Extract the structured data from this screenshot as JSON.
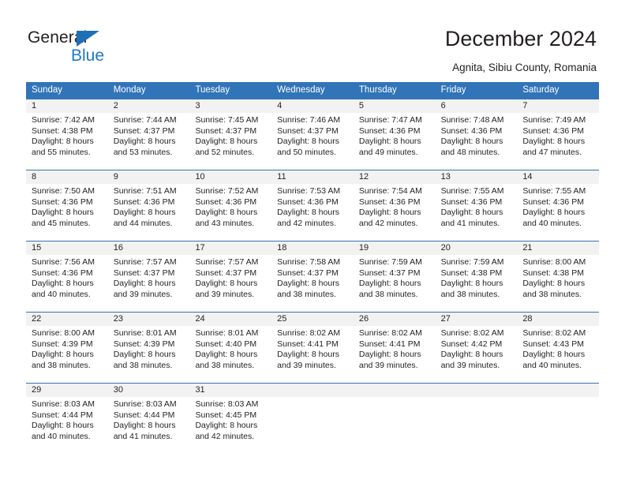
{
  "brand": {
    "name_part1": "General",
    "name_part2": "Blue",
    "triangle_color": "#1f6fb5",
    "blue_color": "#1f7ac4"
  },
  "header": {
    "title": "December 2024",
    "subtitle": "Agnita, Sibiu County, Romania"
  },
  "theme": {
    "header_blue": "#3174b8",
    "daynum_band": "#f2f2f2",
    "text": "#231f20"
  },
  "calendar": {
    "weekday_headers": [
      "Sunday",
      "Monday",
      "Tuesday",
      "Wednesday",
      "Thursday",
      "Friday",
      "Saturday"
    ],
    "weeks": [
      {
        "days": [
          {
            "num": "1",
            "sunrise": "Sunrise: 7:42 AM",
            "sunset": "Sunset: 4:38 PM",
            "daylight1": "Daylight: 8 hours",
            "daylight2": "and 55 minutes."
          },
          {
            "num": "2",
            "sunrise": "Sunrise: 7:44 AM",
            "sunset": "Sunset: 4:37 PM",
            "daylight1": "Daylight: 8 hours",
            "daylight2": "and 53 minutes."
          },
          {
            "num": "3",
            "sunrise": "Sunrise: 7:45 AM",
            "sunset": "Sunset: 4:37 PM",
            "daylight1": "Daylight: 8 hours",
            "daylight2": "and 52 minutes."
          },
          {
            "num": "4",
            "sunrise": "Sunrise: 7:46 AM",
            "sunset": "Sunset: 4:37 PM",
            "daylight1": "Daylight: 8 hours",
            "daylight2": "and 50 minutes."
          },
          {
            "num": "5",
            "sunrise": "Sunrise: 7:47 AM",
            "sunset": "Sunset: 4:36 PM",
            "daylight1": "Daylight: 8 hours",
            "daylight2": "and 49 minutes."
          },
          {
            "num": "6",
            "sunrise": "Sunrise: 7:48 AM",
            "sunset": "Sunset: 4:36 PM",
            "daylight1": "Daylight: 8 hours",
            "daylight2": "and 48 minutes."
          },
          {
            "num": "7",
            "sunrise": "Sunrise: 7:49 AM",
            "sunset": "Sunset: 4:36 PM",
            "daylight1": "Daylight: 8 hours",
            "daylight2": "and 47 minutes."
          }
        ]
      },
      {
        "days": [
          {
            "num": "8",
            "sunrise": "Sunrise: 7:50 AM",
            "sunset": "Sunset: 4:36 PM",
            "daylight1": "Daylight: 8 hours",
            "daylight2": "and 45 minutes."
          },
          {
            "num": "9",
            "sunrise": "Sunrise: 7:51 AM",
            "sunset": "Sunset: 4:36 PM",
            "daylight1": "Daylight: 8 hours",
            "daylight2": "and 44 minutes."
          },
          {
            "num": "10",
            "sunrise": "Sunrise: 7:52 AM",
            "sunset": "Sunset: 4:36 PM",
            "daylight1": "Daylight: 8 hours",
            "daylight2": "and 43 minutes."
          },
          {
            "num": "11",
            "sunrise": "Sunrise: 7:53 AM",
            "sunset": "Sunset: 4:36 PM",
            "daylight1": "Daylight: 8 hours",
            "daylight2": "and 42 minutes."
          },
          {
            "num": "12",
            "sunrise": "Sunrise: 7:54 AM",
            "sunset": "Sunset: 4:36 PM",
            "daylight1": "Daylight: 8 hours",
            "daylight2": "and 42 minutes."
          },
          {
            "num": "13",
            "sunrise": "Sunrise: 7:55 AM",
            "sunset": "Sunset: 4:36 PM",
            "daylight1": "Daylight: 8 hours",
            "daylight2": "and 41 minutes."
          },
          {
            "num": "14",
            "sunrise": "Sunrise: 7:55 AM",
            "sunset": "Sunset: 4:36 PM",
            "daylight1": "Daylight: 8 hours",
            "daylight2": "and 40 minutes."
          }
        ]
      },
      {
        "days": [
          {
            "num": "15",
            "sunrise": "Sunrise: 7:56 AM",
            "sunset": "Sunset: 4:36 PM",
            "daylight1": "Daylight: 8 hours",
            "daylight2": "and 40 minutes."
          },
          {
            "num": "16",
            "sunrise": "Sunrise: 7:57 AM",
            "sunset": "Sunset: 4:37 PM",
            "daylight1": "Daylight: 8 hours",
            "daylight2": "and 39 minutes."
          },
          {
            "num": "17",
            "sunrise": "Sunrise: 7:57 AM",
            "sunset": "Sunset: 4:37 PM",
            "daylight1": "Daylight: 8 hours",
            "daylight2": "and 39 minutes."
          },
          {
            "num": "18",
            "sunrise": "Sunrise: 7:58 AM",
            "sunset": "Sunset: 4:37 PM",
            "daylight1": "Daylight: 8 hours",
            "daylight2": "and 38 minutes."
          },
          {
            "num": "19",
            "sunrise": "Sunrise: 7:59 AM",
            "sunset": "Sunset: 4:37 PM",
            "daylight1": "Daylight: 8 hours",
            "daylight2": "and 38 minutes."
          },
          {
            "num": "20",
            "sunrise": "Sunrise: 7:59 AM",
            "sunset": "Sunset: 4:38 PM",
            "daylight1": "Daylight: 8 hours",
            "daylight2": "and 38 minutes."
          },
          {
            "num": "21",
            "sunrise": "Sunrise: 8:00 AM",
            "sunset": "Sunset: 4:38 PM",
            "daylight1": "Daylight: 8 hours",
            "daylight2": "and 38 minutes."
          }
        ]
      },
      {
        "days": [
          {
            "num": "22",
            "sunrise": "Sunrise: 8:00 AM",
            "sunset": "Sunset: 4:39 PM",
            "daylight1": "Daylight: 8 hours",
            "daylight2": "and 38 minutes."
          },
          {
            "num": "23",
            "sunrise": "Sunrise: 8:01 AM",
            "sunset": "Sunset: 4:39 PM",
            "daylight1": "Daylight: 8 hours",
            "daylight2": "and 38 minutes."
          },
          {
            "num": "24",
            "sunrise": "Sunrise: 8:01 AM",
            "sunset": "Sunset: 4:40 PM",
            "daylight1": "Daylight: 8 hours",
            "daylight2": "and 38 minutes."
          },
          {
            "num": "25",
            "sunrise": "Sunrise: 8:02 AM",
            "sunset": "Sunset: 4:41 PM",
            "daylight1": "Daylight: 8 hours",
            "daylight2": "and 39 minutes."
          },
          {
            "num": "26",
            "sunrise": "Sunrise: 8:02 AM",
            "sunset": "Sunset: 4:41 PM",
            "daylight1": "Daylight: 8 hours",
            "daylight2": "and 39 minutes."
          },
          {
            "num": "27",
            "sunrise": "Sunrise: 8:02 AM",
            "sunset": "Sunset: 4:42 PM",
            "daylight1": "Daylight: 8 hours",
            "daylight2": "and 39 minutes."
          },
          {
            "num": "28",
            "sunrise": "Sunrise: 8:02 AM",
            "sunset": "Sunset: 4:43 PM",
            "daylight1": "Daylight: 8 hours",
            "daylight2": "and 40 minutes."
          }
        ]
      },
      {
        "days": [
          {
            "num": "29",
            "sunrise": "Sunrise: 8:03 AM",
            "sunset": "Sunset: 4:44 PM",
            "daylight1": "Daylight: 8 hours",
            "daylight2": "and 40 minutes."
          },
          {
            "num": "30",
            "sunrise": "Sunrise: 8:03 AM",
            "sunset": "Sunset: 4:44 PM",
            "daylight1": "Daylight: 8 hours",
            "daylight2": "and 41 minutes."
          },
          {
            "num": "31",
            "sunrise": "Sunrise: 8:03 AM",
            "sunset": "Sunset: 4:45 PM",
            "daylight1": "Daylight: 8 hours",
            "daylight2": "and 42 minutes."
          },
          {
            "num": "",
            "sunrise": "",
            "sunset": "",
            "daylight1": "",
            "daylight2": ""
          },
          {
            "num": "",
            "sunrise": "",
            "sunset": "",
            "daylight1": "",
            "daylight2": ""
          },
          {
            "num": "",
            "sunrise": "",
            "sunset": "",
            "daylight1": "",
            "daylight2": ""
          },
          {
            "num": "",
            "sunrise": "",
            "sunset": "",
            "daylight1": "",
            "daylight2": ""
          }
        ]
      }
    ]
  }
}
